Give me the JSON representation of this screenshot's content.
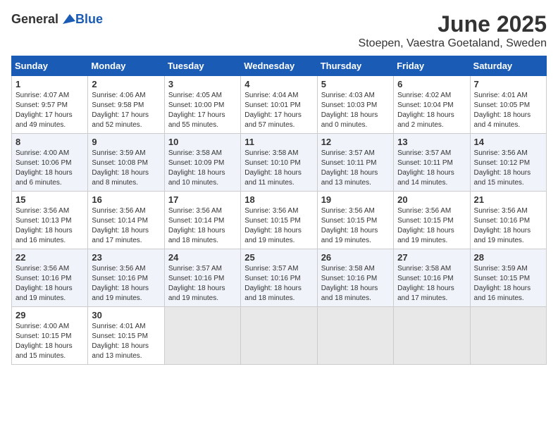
{
  "logo": {
    "general": "General",
    "blue": "Blue"
  },
  "header": {
    "month": "June 2025",
    "location": "Stoepen, Vaestra Goetaland, Sweden"
  },
  "weekdays": [
    "Sunday",
    "Monday",
    "Tuesday",
    "Wednesday",
    "Thursday",
    "Friday",
    "Saturday"
  ],
  "weeks": [
    [
      {
        "day": "1",
        "sunrise": "4:07 AM",
        "sunset": "9:57 PM",
        "daylight": "17 hours and 49 minutes."
      },
      {
        "day": "2",
        "sunrise": "4:06 AM",
        "sunset": "9:58 PM",
        "daylight": "17 hours and 52 minutes."
      },
      {
        "day": "3",
        "sunrise": "4:05 AM",
        "sunset": "10:00 PM",
        "daylight": "17 hours and 55 minutes."
      },
      {
        "day": "4",
        "sunrise": "4:04 AM",
        "sunset": "10:01 PM",
        "daylight": "17 hours and 57 minutes."
      },
      {
        "day": "5",
        "sunrise": "4:03 AM",
        "sunset": "10:03 PM",
        "daylight": "18 hours and 0 minutes."
      },
      {
        "day": "6",
        "sunrise": "4:02 AM",
        "sunset": "10:04 PM",
        "daylight": "18 hours and 2 minutes."
      },
      {
        "day": "7",
        "sunrise": "4:01 AM",
        "sunset": "10:05 PM",
        "daylight": "18 hours and 4 minutes."
      }
    ],
    [
      {
        "day": "8",
        "sunrise": "4:00 AM",
        "sunset": "10:06 PM",
        "daylight": "18 hours and 6 minutes."
      },
      {
        "day": "9",
        "sunrise": "3:59 AM",
        "sunset": "10:08 PM",
        "daylight": "18 hours and 8 minutes."
      },
      {
        "day": "10",
        "sunrise": "3:58 AM",
        "sunset": "10:09 PM",
        "daylight": "18 hours and 10 minutes."
      },
      {
        "day": "11",
        "sunrise": "3:58 AM",
        "sunset": "10:10 PM",
        "daylight": "18 hours and 11 minutes."
      },
      {
        "day": "12",
        "sunrise": "3:57 AM",
        "sunset": "10:11 PM",
        "daylight": "18 hours and 13 minutes."
      },
      {
        "day": "13",
        "sunrise": "3:57 AM",
        "sunset": "10:11 PM",
        "daylight": "18 hours and 14 minutes."
      },
      {
        "day": "14",
        "sunrise": "3:56 AM",
        "sunset": "10:12 PM",
        "daylight": "18 hours and 15 minutes."
      }
    ],
    [
      {
        "day": "15",
        "sunrise": "3:56 AM",
        "sunset": "10:13 PM",
        "daylight": "18 hours and 16 minutes."
      },
      {
        "day": "16",
        "sunrise": "3:56 AM",
        "sunset": "10:14 PM",
        "daylight": "18 hours and 17 minutes."
      },
      {
        "day": "17",
        "sunrise": "3:56 AM",
        "sunset": "10:14 PM",
        "daylight": "18 hours and 18 minutes."
      },
      {
        "day": "18",
        "sunrise": "3:56 AM",
        "sunset": "10:15 PM",
        "daylight": "18 hours and 19 minutes."
      },
      {
        "day": "19",
        "sunrise": "3:56 AM",
        "sunset": "10:15 PM",
        "daylight": "18 hours and 19 minutes."
      },
      {
        "day": "20",
        "sunrise": "3:56 AM",
        "sunset": "10:15 PM",
        "daylight": "18 hours and 19 minutes."
      },
      {
        "day": "21",
        "sunrise": "3:56 AM",
        "sunset": "10:16 PM",
        "daylight": "18 hours and 19 minutes."
      }
    ],
    [
      {
        "day": "22",
        "sunrise": "3:56 AM",
        "sunset": "10:16 PM",
        "daylight": "18 hours and 19 minutes."
      },
      {
        "day": "23",
        "sunrise": "3:56 AM",
        "sunset": "10:16 PM",
        "daylight": "18 hours and 19 minutes."
      },
      {
        "day": "24",
        "sunrise": "3:57 AM",
        "sunset": "10:16 PM",
        "daylight": "18 hours and 19 minutes."
      },
      {
        "day": "25",
        "sunrise": "3:57 AM",
        "sunset": "10:16 PM",
        "daylight": "18 hours and 18 minutes."
      },
      {
        "day": "26",
        "sunrise": "3:58 AM",
        "sunset": "10:16 PM",
        "daylight": "18 hours and 18 minutes."
      },
      {
        "day": "27",
        "sunrise": "3:58 AM",
        "sunset": "10:16 PM",
        "daylight": "18 hours and 17 minutes."
      },
      {
        "day": "28",
        "sunrise": "3:59 AM",
        "sunset": "10:15 PM",
        "daylight": "18 hours and 16 minutes."
      }
    ],
    [
      {
        "day": "29",
        "sunrise": "4:00 AM",
        "sunset": "10:15 PM",
        "daylight": "18 hours and 15 minutes."
      },
      {
        "day": "30",
        "sunrise": "4:01 AM",
        "sunset": "10:15 PM",
        "daylight": "18 hours and 13 minutes."
      },
      null,
      null,
      null,
      null,
      null
    ]
  ]
}
